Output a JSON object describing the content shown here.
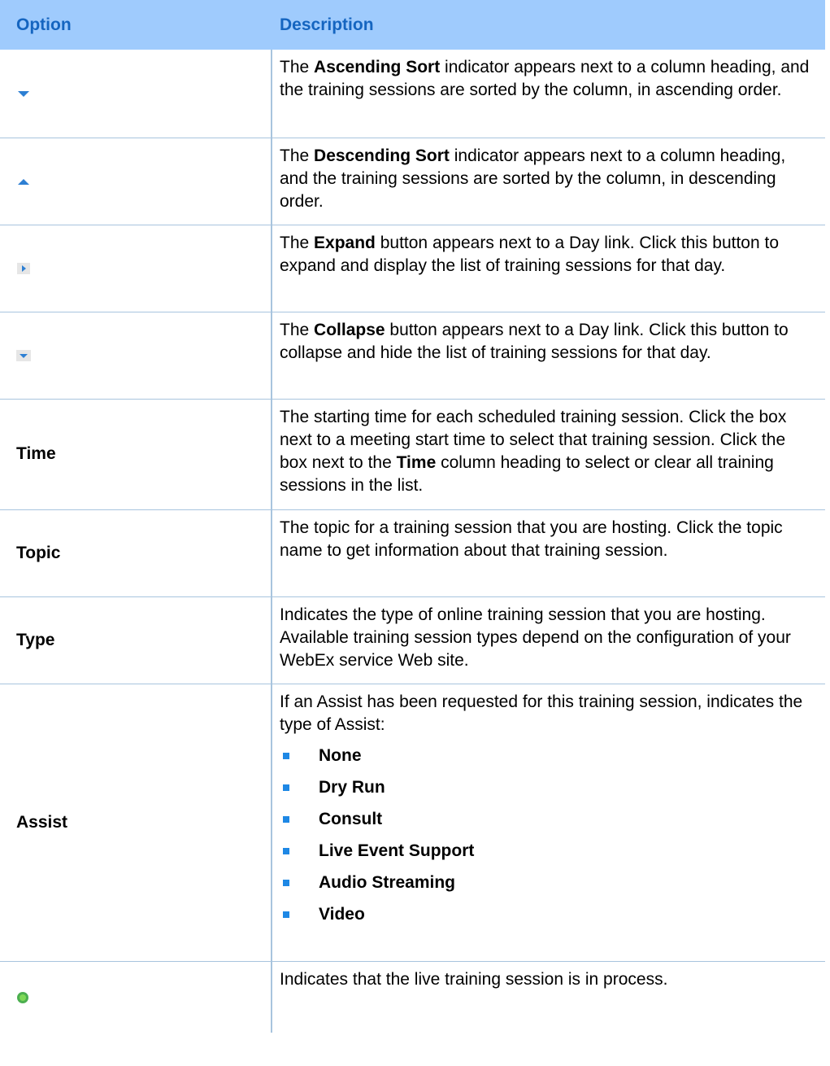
{
  "header": {
    "option": "Option",
    "description": "Description"
  },
  "rows": {
    "ascending": {
      "icon": "sort-ascending-arrow-icon",
      "pre": "The ",
      "bold": "Ascending Sort",
      "post": " indicator appears next to a column heading, and the training sessions are sorted by the column, in ascending order."
    },
    "descending": {
      "icon": "sort-descending-arrow-icon",
      "pre": "The ",
      "bold": "Descending Sort",
      "post": " indicator appears next to a column heading, and the training sessions are sorted by the column, in descending order."
    },
    "expand": {
      "icon": "expand-arrow-icon",
      "pre": "The ",
      "bold": "Expand",
      "post": " button appears next to a Day link. Click this button to expand and display the list of training sessions for that day."
    },
    "collapse": {
      "icon": "collapse-arrow-icon",
      "pre": "The ",
      "bold": "Collapse",
      "post": " button appears next to a Day link. Click this button to collapse and hide the list of training sessions for that day."
    },
    "time": {
      "label": "Time",
      "pre": "The starting time for each scheduled training session. Click the box next to a meeting start time to select that training session. Click the box next to the ",
      "bold": "Time",
      "post": " column heading to select or clear all training sessions in the list."
    },
    "topic": {
      "label": "Topic",
      "text": "The topic for a training session that you are hosting. Click the topic name to get information about that training session."
    },
    "type": {
      "label": "Type",
      "text": "Indicates the type of online training session that you are hosting. Available training session types depend on the configuration of your WebEx service Web site."
    },
    "assist": {
      "label": "Assist",
      "text": "If an Assist has been requested for this training session, indicates the type of Assist:",
      "items": [
        "None",
        "Dry Run",
        "Consult",
        "Live Event Support",
        "Audio Streaming",
        "Video"
      ]
    },
    "in_process": {
      "icon": "green-status-dot-icon",
      "text": "Indicates that the live training session is in process."
    }
  },
  "colors": {
    "header_bg": "#9fcbfd",
    "header_text": "#1565c0",
    "bullet": "#1e88e5",
    "icon_blue": "#2d7fd3",
    "status_green": "#4caf50"
  }
}
